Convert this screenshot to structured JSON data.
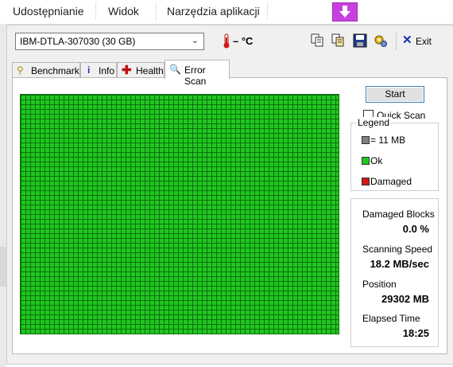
{
  "ribbon": {
    "tabs": [
      "Udostępnianie",
      "Widok",
      "Narzędzia aplikacji"
    ]
  },
  "toolbar": {
    "drive": "IBM-DTLA-307030 (30 GB)",
    "temperature": "– °C",
    "icons": [
      "copy-icon",
      "copy-all-icon",
      "save-icon",
      "options-icon"
    ],
    "exit_label": "Exit"
  },
  "tabs": [
    {
      "label": "Benchmark",
      "icon": "benchmark-icon"
    },
    {
      "label": "Info",
      "icon": "info-icon"
    },
    {
      "label": "Health",
      "icon": "health-icon"
    },
    {
      "label": "Error Scan",
      "icon": "error-scan-icon",
      "active": true
    }
  ],
  "scan": {
    "start_label": "Start",
    "quick_scan_label": "Quick Scan",
    "quick_scan_checked": false,
    "legend_title": "Legend",
    "legend": [
      {
        "label": "= 11 MB",
        "color": "#808080"
      },
      {
        "label": "Ok",
        "color": "#1ec81e"
      },
      {
        "label": "Damaged",
        "color": "#d01818"
      }
    ],
    "stats": [
      {
        "label": "Damaged Blocks",
        "value": "0.0 %"
      },
      {
        "label": "Scanning Speed",
        "value": "18.2 MB/sec"
      },
      {
        "label": "Position",
        "value": "29302 MB"
      },
      {
        "label": "Elapsed Time",
        "value": "18:25"
      }
    ],
    "block_color": "#1ec81e"
  }
}
